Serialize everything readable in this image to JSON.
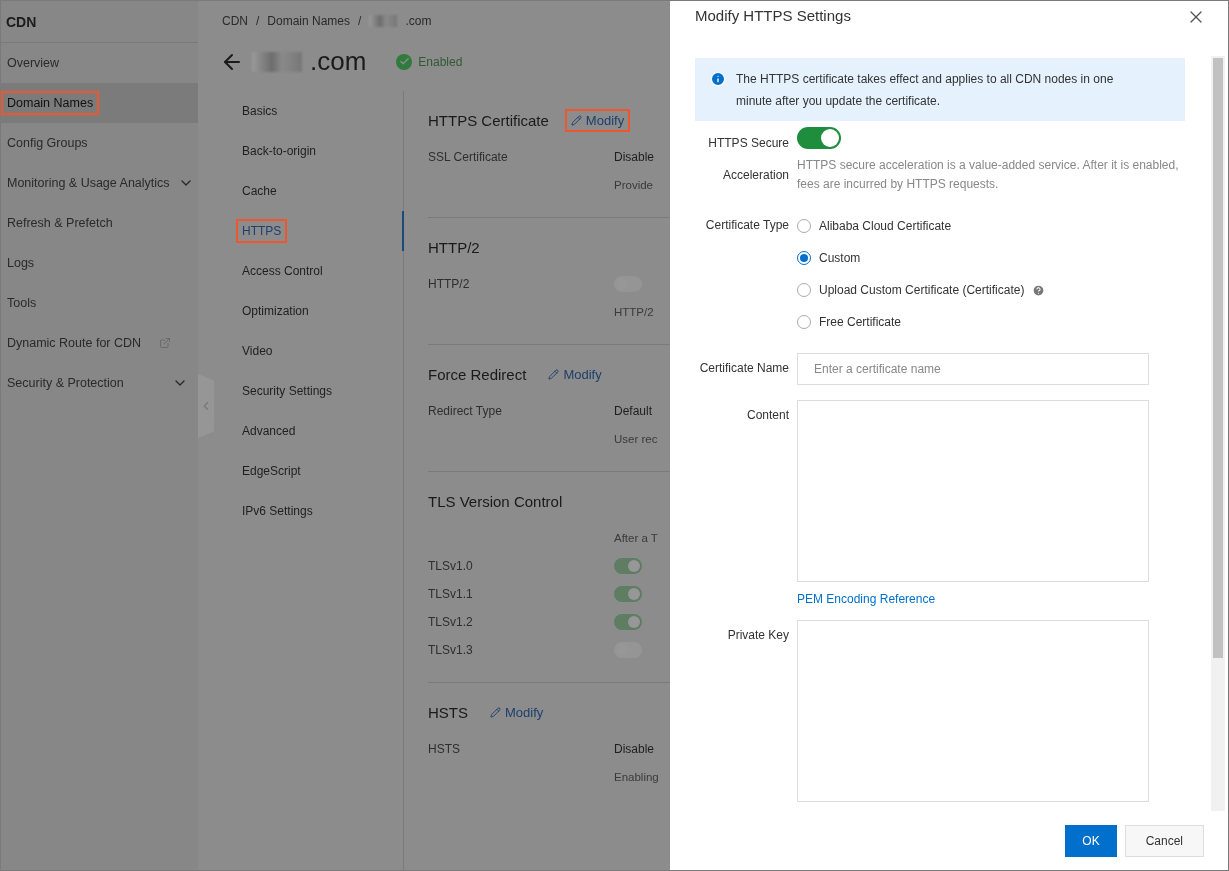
{
  "sidebar": {
    "title": "CDN",
    "items": [
      {
        "label": "Overview",
        "selected": false,
        "highlighted": false,
        "kind": "plain"
      },
      {
        "label": "Domain Names",
        "selected": true,
        "highlighted": true,
        "kind": "plain"
      },
      {
        "label": "Config Groups",
        "selected": false,
        "highlighted": false,
        "kind": "plain"
      },
      {
        "label": "Monitoring & Usage Analytics",
        "selected": false,
        "highlighted": false,
        "kind": "expandable"
      },
      {
        "label": "Refresh & Prefetch",
        "selected": false,
        "highlighted": false,
        "kind": "plain"
      },
      {
        "label": "Logs",
        "selected": false,
        "highlighted": false,
        "kind": "plain"
      },
      {
        "label": "Tools",
        "selected": false,
        "highlighted": false,
        "kind": "plain"
      },
      {
        "label": "Dynamic Route for CDN",
        "selected": false,
        "highlighted": false,
        "kind": "external"
      },
      {
        "label": "Security & Protection",
        "selected": false,
        "highlighted": false,
        "kind": "expandable"
      }
    ]
  },
  "breadcrumb": {
    "items": [
      "CDN",
      "Domain Names",
      ".com"
    ],
    "separator": "/"
  },
  "domain": {
    "name": ".com",
    "status": "Enabled"
  },
  "subnav": [
    {
      "label": "Basics",
      "selected": false,
      "highlighted": false
    },
    {
      "label": "Back-to-origin",
      "selected": false,
      "highlighted": false
    },
    {
      "label": "Cache",
      "selected": false,
      "highlighted": false
    },
    {
      "label": "HTTPS",
      "selected": true,
      "highlighted": true
    },
    {
      "label": "Access Control",
      "selected": false,
      "highlighted": false
    },
    {
      "label": "Optimization",
      "selected": false,
      "highlighted": false
    },
    {
      "label": "Video",
      "selected": false,
      "highlighted": false
    },
    {
      "label": "Security Settings",
      "selected": false,
      "highlighted": false
    },
    {
      "label": "Advanced",
      "selected": false,
      "highlighted": false
    },
    {
      "label": "EdgeScript",
      "selected": false,
      "highlighted": false
    },
    {
      "label": "IPv6 Settings",
      "selected": false,
      "highlighted": false
    }
  ],
  "sections": [
    {
      "title": "HTTPS Certificate",
      "action": "Modify",
      "action_highlighted": true,
      "rows": [
        {
          "kind": "text",
          "label": "SSL Certificate",
          "value": "Disable",
          "note": "Provide"
        }
      ]
    },
    {
      "title": "HTTP/2",
      "rows": [
        {
          "kind": "switch",
          "label": "HTTP/2",
          "on": false,
          "note": "HTTP/2"
        }
      ]
    },
    {
      "title": "Force Redirect",
      "action": "Modify",
      "action_highlighted": false,
      "rows": [
        {
          "kind": "text",
          "label": "Redirect Type",
          "value": "Default",
          "note": "User rec"
        }
      ]
    },
    {
      "title": "TLS Version Control",
      "header_note": "After a T",
      "rows": [
        {
          "kind": "switch",
          "label": "TLSv1.0",
          "on": true
        },
        {
          "kind": "switch",
          "label": "TLSv1.1",
          "on": true
        },
        {
          "kind": "switch",
          "label": "TLSv1.2",
          "on": true
        },
        {
          "kind": "switch",
          "label": "TLSv1.3",
          "on": false
        }
      ]
    },
    {
      "title": "HSTS",
      "action": "Modify",
      "action_highlighted": false,
      "rows": [
        {
          "kind": "text",
          "label": "HSTS",
          "value": "Disable",
          "note": "Enabling"
        }
      ]
    }
  ],
  "drawer": {
    "title": "Modify HTTPS Settings",
    "info": "The HTTPS certificate takes effect and applies to all CDN nodes in one minute after you update the certificate.",
    "secure_acceleration": {
      "label_lines": [
        "HTTPS Secure",
        "Acceleration"
      ],
      "on": true,
      "help": "HTTPS secure acceleration is a value-added service. After it is enabled, fees are incurred by HTTPS requests."
    },
    "certificate_type": {
      "label": "Certificate Type",
      "options": [
        {
          "label": "Alibaba Cloud Certificate",
          "selected": false,
          "help": false
        },
        {
          "label": "Custom",
          "selected": true,
          "help": false
        },
        {
          "label": "Upload Custom Certificate (Certificate)",
          "selected": false,
          "help": true
        },
        {
          "label": "Free Certificate",
          "selected": false,
          "help": false
        }
      ]
    },
    "certificate_name": {
      "label": "Certificate Name",
      "placeholder": "Enter a certificate name"
    },
    "content": {
      "label": "Content",
      "link": "PEM Encoding Reference"
    },
    "private_key": {
      "label": "Private Key"
    },
    "buttons": [
      {
        "label": "OK",
        "kind": "primary"
      },
      {
        "label": "Cancel",
        "kind": "default"
      }
    ]
  }
}
